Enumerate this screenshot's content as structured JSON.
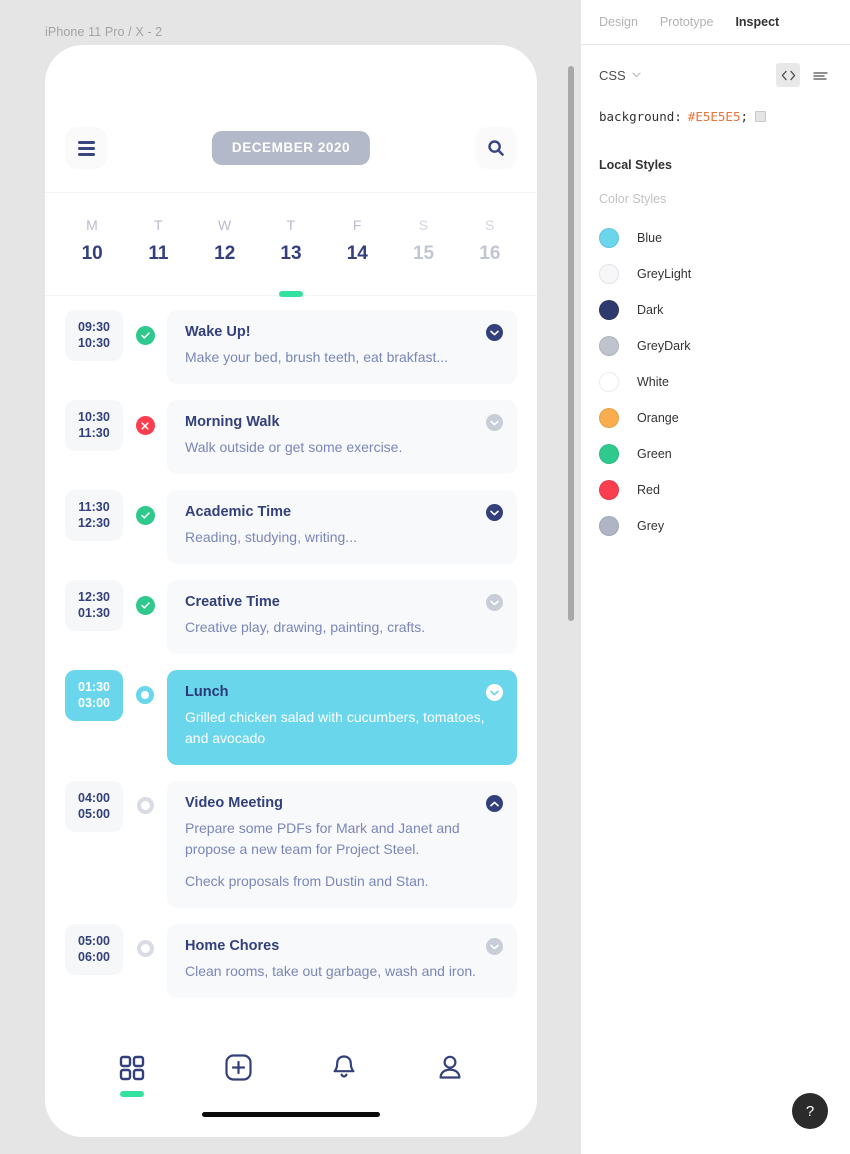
{
  "canvas": {
    "frame_label": "iPhone 11 Pro / X - 2",
    "background_color": "#E5E5E5"
  },
  "phone": {
    "header": {
      "menu_icon": "hamburger-icon",
      "month_label": "DECEMBER 2020",
      "search_icon": "search-icon"
    },
    "week": {
      "days": [
        {
          "dow": "M",
          "num": "10",
          "muted": false,
          "selected": false
        },
        {
          "dow": "T",
          "num": "11",
          "muted": false,
          "selected": false
        },
        {
          "dow": "W",
          "num": "12",
          "muted": false,
          "selected": false
        },
        {
          "dow": "T",
          "num": "13",
          "muted": false,
          "selected": true
        },
        {
          "dow": "F",
          "num": "14",
          "muted": false,
          "selected": false
        },
        {
          "dow": "S",
          "num": "15",
          "muted": true,
          "selected": false
        },
        {
          "dow": "S",
          "num": "16",
          "muted": true,
          "selected": false
        }
      ]
    },
    "events": [
      {
        "start": "09:30",
        "end": "10:30",
        "status": "done",
        "status_icon": "check-icon",
        "title": "Wake Up!",
        "lines": [
          "Make your bed, brush teeth, eat brakfast..."
        ],
        "chevron": "chevron-down-icon",
        "chevron_style": "dark",
        "highlighted": false
      },
      {
        "start": "10:30",
        "end": "11:30",
        "status": "missed",
        "status_icon": "close-icon",
        "title": "Morning Walk",
        "lines": [
          "Walk outside or get some exercise."
        ],
        "chevron": "chevron-down-icon",
        "chevron_style": "grey",
        "highlighted": false
      },
      {
        "start": "11:30",
        "end": "12:30",
        "status": "done",
        "status_icon": "check-icon",
        "title": "Academic Time",
        "lines": [
          "Reading, studying, writing..."
        ],
        "chevron": "chevron-down-icon",
        "chevron_style": "dark",
        "highlighted": false
      },
      {
        "start": "12:30",
        "end": "01:30",
        "status": "done",
        "status_icon": "check-icon",
        "title": "Creative Time",
        "lines": [
          "Creative play, drawing, painting, crafts."
        ],
        "chevron": "chevron-down-icon",
        "chevron_style": "grey",
        "highlighted": false
      },
      {
        "start": "01:30",
        "end": "03:00",
        "status": "active",
        "status_icon": "dot-icon",
        "title": "Lunch",
        "lines": [
          "Grilled chicken salad with cucumbers, tomatoes, and avocado"
        ],
        "chevron": "chevron-down-icon",
        "chevron_style": "white",
        "highlighted": true
      },
      {
        "start": "04:00",
        "end": "05:00",
        "status": "pending",
        "status_icon": "dot-icon",
        "title": "Video Meeting",
        "lines": [
          "Prepare some PDFs for Mark and Janet and propose a new team for Project Steel.",
          "Check proposals from Dustin and Stan."
        ],
        "chevron": "chevron-up-icon",
        "chevron_style": "dark",
        "highlighted": false
      },
      {
        "start": "05:00",
        "end": "06:00",
        "status": "pending",
        "status_icon": "dot-icon",
        "title": "Home Chores",
        "lines": [
          "Clean rooms, take out garbage, wash and iron."
        ],
        "chevron": "chevron-down-icon",
        "chevron_style": "grey",
        "highlighted": false
      }
    ],
    "bottom_nav": [
      {
        "icon": "grid-icon",
        "active": true
      },
      {
        "icon": "plus-square-icon",
        "active": false
      },
      {
        "icon": "bell-icon",
        "active": false
      },
      {
        "icon": "user-icon",
        "active": false
      }
    ]
  },
  "panel": {
    "tabs": [
      {
        "label": "Design",
        "active": false
      },
      {
        "label": "Prototype",
        "active": false
      },
      {
        "label": "Inspect",
        "active": true
      }
    ],
    "css_select_label": "CSS",
    "code_icon": "code-icon",
    "list_icon": "list-icon",
    "code": {
      "property": "background:",
      "value": "#E5E5E5",
      "terminator": ";"
    },
    "local_styles_title": "Local Styles",
    "color_styles_title": "Color Styles",
    "color_styles": [
      {
        "name": "Blue",
        "color": "#6BD5EC"
      },
      {
        "name": "GreyLight",
        "color": "#F7F7F9"
      },
      {
        "name": "Dark",
        "color": "#2E3A6E"
      },
      {
        "name": "GreyDark",
        "color": "#BFC3CC"
      },
      {
        "name": "White",
        "color": "#FFFFFF"
      },
      {
        "name": "Orange",
        "color": "#F9AD4E"
      },
      {
        "name": "Green",
        "color": "#2FC98E"
      },
      {
        "name": "Red",
        "color": "#FA3E50"
      },
      {
        "name": "Grey",
        "color": "#AFB5C4"
      }
    ],
    "help_label": "?"
  }
}
